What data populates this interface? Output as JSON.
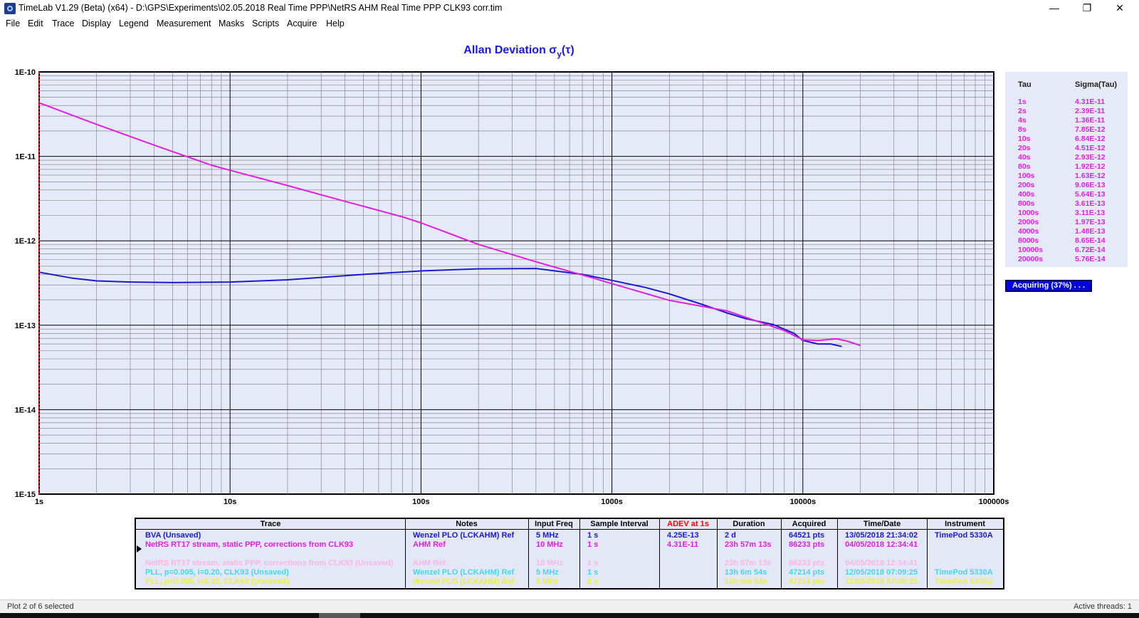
{
  "window": {
    "title": "TimeLab V1.29 (Beta) (x64) - D:\\GPS\\Experiments\\02.05.2018 Real Time PPP\\NetRS AHM Real Time PPP CLK93 corr.tim",
    "minimize": "—",
    "maximize": "❐",
    "close": "✕",
    "icon": "timelab-app-icon"
  },
  "menu": [
    "File",
    "Edit",
    "Trace",
    "Display",
    "Legend",
    "Measurement",
    "Masks",
    "Scripts",
    "Acquire",
    "Help"
  ],
  "chart_title": {
    "prefix": "Allan Deviation σ",
    "subscript": "y",
    "suffix": "(τ)"
  },
  "colors": {
    "plot_bg": "#e6e9f7",
    "bva": "#1a1ad0",
    "netrs": "#e020e0",
    "title": "#1a1ae0",
    "adev_header": "#ff0000",
    "faded_pink": "#f5b8e8",
    "faded_cyan": "#40d8f0",
    "faded_yellow": "#e8f040",
    "faded_green": "#b8f0b8"
  },
  "chart_data": {
    "type": "line",
    "x_scale": "log",
    "y_scale": "log",
    "xlim": [
      1,
      100000
    ],
    "ylim": [
      1e-15,
      1e-10
    ],
    "grid": true,
    "x_tick_labels": [
      "1s",
      "10s",
      "100s",
      "1000s",
      "10000s",
      "100000s"
    ],
    "y_tick_labels": [
      "1E-10",
      "1E-11",
      "1E-12",
      "1E-13",
      "1E-14",
      "1E-15"
    ],
    "series": [
      {
        "name": "BVA (Unsaved)",
        "color": "#1a1ad0",
        "x": [
          1,
          1.5,
          2,
          3,
          5,
          10,
          20,
          50,
          100,
          200,
          400,
          700,
          1000,
          1500,
          2000,
          3000,
          4000,
          5000,
          7000,
          9000,
          10000,
          12000,
          14000,
          16000
        ],
        "y": [
          4.25e-13,
          3.6e-13,
          3.35e-13,
          3.25e-13,
          3.2e-13,
          3.25e-13,
          3.45e-13,
          4e-13,
          4.4e-13,
          4.65e-13,
          4.7e-13,
          4e-13,
          3.4e-13,
          2.8e-13,
          2.35e-13,
          1.75e-13,
          1.4e-13,
          1.2e-13,
          1.02e-13,
          8e-14,
          6.6e-14,
          6e-14,
          6e-14,
          5.6e-14
        ]
      },
      {
        "name": "NetRS RT17 stream, static PPP, corrections from CLK93",
        "color": "#e020e0",
        "x": [
          1,
          2,
          4,
          8,
          10,
          20,
          40,
          80,
          100,
          200,
          400,
          800,
          1000,
          2000,
          4000,
          8000,
          10000,
          12000,
          15000,
          17000,
          20000
        ],
        "y": [
          4.31e-11,
          2.39e-11,
          1.36e-11,
          7.85e-12,
          6.84e-12,
          4.51e-12,
          2.93e-12,
          1.92e-12,
          1.63e-12,
          9.06e-13,
          5.64e-13,
          3.61e-13,
          3.11e-13,
          1.97e-13,
          1.48e-13,
          8.65e-14,
          6.72e-14,
          6.6e-14,
          6.9e-14,
          6.5e-14,
          5.76e-14
        ]
      }
    ]
  },
  "sigma_table": {
    "headers": [
      "Tau",
      "Sigma(Tau)"
    ],
    "rows": [
      [
        "1s",
        "4.31E-11"
      ],
      [
        "2s",
        "2.39E-11"
      ],
      [
        "4s",
        "1.36E-11"
      ],
      [
        "8s",
        "7.85E-12"
      ],
      [
        "10s",
        "6.84E-12"
      ],
      [
        "20s",
        "4.51E-12"
      ],
      [
        "40s",
        "2.93E-12"
      ],
      [
        "80s",
        "1.92E-12"
      ],
      [
        "100s",
        "1.63E-12"
      ],
      [
        "200s",
        "9.06E-13"
      ],
      [
        "400s",
        "5.64E-13"
      ],
      [
        "800s",
        "3.61E-13"
      ],
      [
        "1000s",
        "3.11E-13"
      ],
      [
        "2000s",
        "1.97E-13"
      ],
      [
        "4000s",
        "1.48E-13"
      ],
      [
        "8000s",
        "8.65E-14"
      ],
      [
        "10000s",
        "6.72E-14"
      ],
      [
        "20000s",
        "5.76E-14"
      ]
    ]
  },
  "acquire_button": "Acquiring (37%) . . .",
  "trace_table": {
    "headers": [
      "Trace",
      "Notes",
      "Input Freq",
      "Sample Interval",
      "ADEV at 1s",
      "Duration",
      "Acquired",
      "Time/Date",
      "Instrument"
    ],
    "rows": [
      {
        "color": "#1a1ad0",
        "cells": [
          "BVA (Unsaved)",
          "Wenzel PLO (LCKAHM) Ref",
          "5 MHz",
          "1 s",
          "4.25E-13",
          "2 d",
          "64521 pts",
          "13/05/2018 21:34:02",
          "TimePod 5330A"
        ]
      },
      {
        "color": "#e020e0",
        "cells": [
          "NetRS RT17 stream, static PPP, corrections from CLK93",
          "AHM Ref",
          "10 MHz",
          "1 s",
          "4.31E-11",
          "23h 57m 13s",
          "86233 pts",
          "04/05/2018 12:34:41",
          ""
        ]
      },
      {
        "color": "#b8f0b8",
        "cells": [
          "",
          "",
          "",
          "",
          "",
          "",
          "",
          "",
          ""
        ]
      },
      {
        "color": "#f5b8e8",
        "cells": [
          "NetRS RT17 stream, static PPP, corrections from CLK93 (Unsaved)",
          "AHM Ref",
          "10 MHz",
          "1 s",
          "",
          "23h 57m 13s",
          "86233 pts",
          "04/05/2018 12:34:41",
          ""
        ]
      },
      {
        "color": "#40d8f0",
        "cells": [
          "PLL, p=0.005, i=0.20, CLK93 (Unsaved)",
          "Wenzel PLO (LCKAHM) Ref",
          "5 MHz",
          "1 s",
          "",
          "13h 6m 54s",
          "47214 pts",
          "12/05/2018 07:09:25",
          "TimePod 5330A"
        ]
      },
      {
        "color": "#e8f040",
        "cells": [
          "PLL, p=0.005, i=0.20, CLK93 (Unsaved)",
          "Wenzel PLO (LCKAHM) Ref",
          "5 MHz",
          "1 s",
          "",
          "13h 6m 54s",
          "47214 pts",
          "12/05/2018 07:09:25",
          "TimePod 5330A"
        ]
      }
    ]
  },
  "status": {
    "left": "Plot 2 of 6 selected",
    "right": "Active threads: 1"
  }
}
